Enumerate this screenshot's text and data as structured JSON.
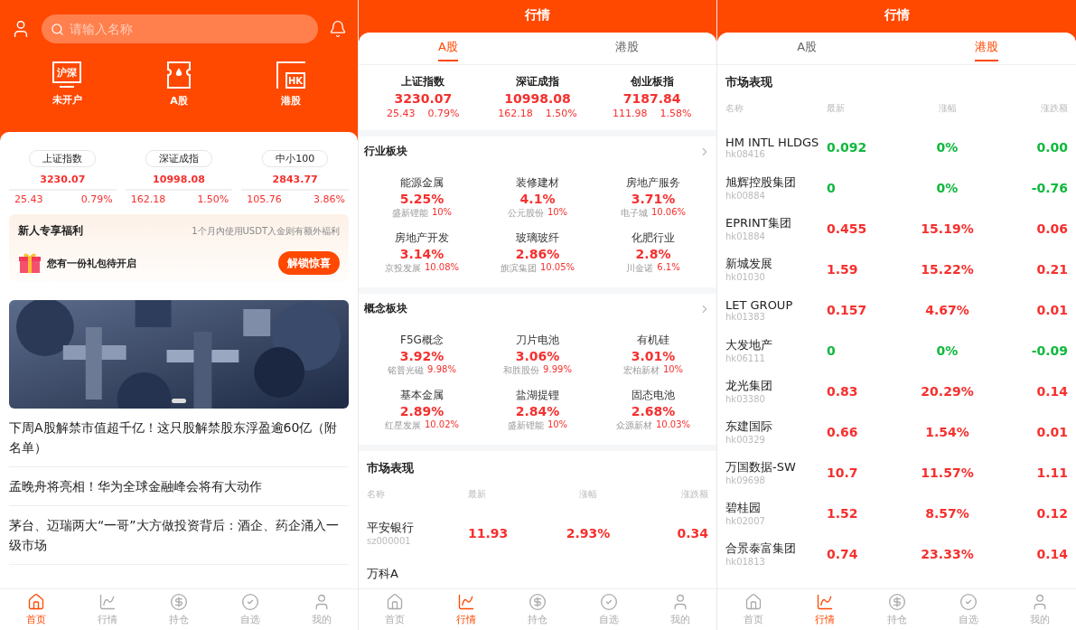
{
  "home": {
    "search": {
      "placeholder": "请输入名称"
    },
    "quick_links": [
      {
        "kind": "monitor",
        "badge": "沪深",
        "label": "未开户"
      },
      {
        "kind": "ticket",
        "label": "A股"
      },
      {
        "kind": "hk",
        "badge": "HK",
        "label": "港股"
      }
    ],
    "indices": [
      {
        "name": "上证指数",
        "value": "3230.07",
        "change": "25.43",
        "percent": "0.79%"
      },
      {
        "name": "深证成指",
        "value": "10998.08",
        "change": "162.18",
        "percent": "1.50%"
      },
      {
        "name": "中小100",
        "value": "2843.77",
        "change": "105.76",
        "percent": "3.86%"
      }
    ],
    "promo": {
      "title": "新人专享福利",
      "subtitle": "1个月内使用USDT入金则有额外福利",
      "gift_text": "您有一份礼包待开启",
      "button": "解锁惊喜"
    },
    "banner": {
      "kind": "picture"
    },
    "news": [
      "下周A股解禁市值超千亿！这只股解禁股东浮盈逾60亿（附名单）",
      "孟晚舟将亮相！华为全球金融峰会将有大动作",
      "茅台、迈瑞两大“一哥”大方做投资背后：酒企、药企涌入一级市场"
    ],
    "bottom_nav": [
      {
        "kind": "home",
        "label": "首页",
        "selected": true
      },
      {
        "kind": "chart",
        "label": "行情",
        "selected": false
      },
      {
        "kind": "yen",
        "label": "持仓",
        "selected": false
      },
      {
        "kind": "check",
        "label": "自选",
        "selected": false
      },
      {
        "kind": "user",
        "label": "我的",
        "selected": false
      }
    ]
  },
  "market_a": {
    "title": "行情",
    "tabs": [
      {
        "label": "A股",
        "selected": true
      },
      {
        "label": "港股",
        "selected": false
      }
    ],
    "indices": [
      {
        "name": "上证指数",
        "value": "3230.07",
        "change": "25.43",
        "percent": "0.79%"
      },
      {
        "name": "深证成指",
        "value": "10998.08",
        "change": "162.18",
        "percent": "1.50%"
      },
      {
        "name": "创业板指",
        "value": "7187.84",
        "change": "111.98",
        "percent": "1.58%"
      }
    ],
    "sectors": [
      {
        "title": "行业板块",
        "items": [
          {
            "name": "能源金属",
            "percent": "5.25%",
            "leader": "盛新锂能",
            "leader_percent": "10%"
          },
          {
            "name": "装修建材",
            "percent": "4.1%",
            "leader": "公元股份",
            "leader_percent": "10%"
          },
          {
            "name": "房地产服务",
            "percent": "3.71%",
            "leader": "电子城",
            "leader_percent": "10.06%"
          },
          {
            "name": "房地产开发",
            "percent": "3.14%",
            "leader": "京投发展",
            "leader_percent": "10.08%"
          },
          {
            "name": "玻璃玻纤",
            "percent": "2.86%",
            "leader": "旗滨集团",
            "leader_percent": "10.05%"
          },
          {
            "name": "化肥行业",
            "percent": "2.8%",
            "leader": "川金诺",
            "leader_percent": "6.1%"
          }
        ]
      },
      {
        "title": "概念板块",
        "items": [
          {
            "name": "F5G概念",
            "percent": "3.92%",
            "leader": "铭普光磁",
            "leader_percent": "9.98%"
          },
          {
            "name": "刀片电池",
            "percent": "3.06%",
            "leader": "和胜股份",
            "leader_percent": "9.99%"
          },
          {
            "name": "有机硅",
            "percent": "3.01%",
            "leader": "宏柏新材",
            "leader_percent": "10%"
          },
          {
            "name": "基本金属",
            "percent": "2.89%",
            "leader": "红星发展",
            "leader_percent": "10.02%"
          },
          {
            "name": "盐湖提锂",
            "percent": "2.84%",
            "leader": "盛新锂能",
            "leader_percent": "10%"
          },
          {
            "name": "固态电池",
            "percent": "2.68%",
            "leader": "众源新材",
            "leader_percent": "10.03%"
          }
        ]
      }
    ],
    "market": {
      "title": "市场表现",
      "columns": [
        "名称",
        "最新",
        "涨幅",
        "涨跌额"
      ],
      "rows": [
        {
          "name": "平安银行",
          "code": "sz000001",
          "latest": "11.93",
          "percent": "2.93%",
          "change": "0.34",
          "rising": true
        },
        {
          "name": "万科A"
        }
      ]
    },
    "bottom_nav": [
      {
        "kind": "home",
        "label": "首页",
        "selected": false
      },
      {
        "kind": "chart",
        "label": "行情",
        "selected": true
      },
      {
        "kind": "yen",
        "label": "持仓",
        "selected": false
      },
      {
        "kind": "check",
        "label": "自选",
        "selected": false
      },
      {
        "kind": "user",
        "label": "我的",
        "selected": false
      }
    ]
  },
  "market_hk": {
    "title": "行情",
    "tabs": [
      {
        "label": "A股",
        "selected": false
      },
      {
        "label": "港股",
        "selected": true
      }
    ],
    "market": {
      "title": "市场表现",
      "columns": [
        "名称",
        "最新",
        "涨幅",
        "涨跌额"
      ],
      "rows": [
        {
          "name": "HM INTL HLDGS",
          "code": "hk08416",
          "latest": "0.092",
          "percent": "0%",
          "change": "0.00",
          "rising": false
        },
        {
          "name": "旭辉控股集团",
          "code": "hk00884",
          "latest": "0",
          "percent": "0%",
          "change": "-0.76",
          "rising": false
        },
        {
          "name": "EPRINT集团",
          "code": "hk01884",
          "latest": "0.455",
          "percent": "15.19%",
          "change": "0.06",
          "rising": true
        },
        {
          "name": "新城发展",
          "code": "hk01030",
          "latest": "1.59",
          "percent": "15.22%",
          "change": "0.21",
          "rising": true
        },
        {
          "name": "LET GROUP",
          "code": "hk01383",
          "latest": "0.157",
          "percent": "4.67%",
          "change": "0.01",
          "rising": true
        },
        {
          "name": "大发地产",
          "code": "hk06111",
          "latest": "0",
          "percent": "0%",
          "change": "-0.09",
          "rising": false
        },
        {
          "name": "龙光集团",
          "code": "hk03380",
          "latest": "0.83",
          "percent": "20.29%",
          "change": "0.14",
          "rising": true
        },
        {
          "name": "东建国际",
          "code": "hk00329",
          "latest": "0.66",
          "percent": "1.54%",
          "change": "0.01",
          "rising": true
        },
        {
          "name": "万国数据-SW",
          "code": "hk09698",
          "latest": "10.7",
          "percent": "11.57%",
          "change": "1.11",
          "rising": true
        },
        {
          "name": "碧桂园",
          "code": "hk02007",
          "latest": "1.52",
          "percent": "8.57%",
          "change": "0.12",
          "rising": true
        },
        {
          "name": "合景泰富集团",
          "code": "hk01813",
          "latest": "0.74",
          "percent": "23.33%",
          "change": "0.14",
          "rising": true
        }
      ]
    },
    "bottom_nav": [
      {
        "kind": "home",
        "label": "首页",
        "selected": false
      },
      {
        "kind": "chart",
        "label": "行情",
        "selected": true
      },
      {
        "kind": "yen",
        "label": "持仓",
        "selected": false
      },
      {
        "kind": "check",
        "label": "自选",
        "selected": false
      },
      {
        "kind": "user",
        "label": "我的",
        "selected": false
      }
    ]
  }
}
